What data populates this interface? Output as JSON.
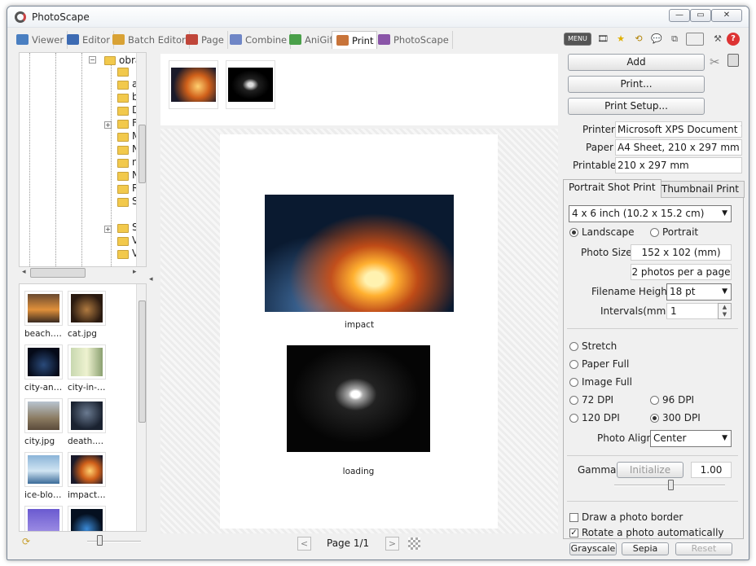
{
  "window": {
    "title": "PhotoScape"
  },
  "window_controls": {
    "minimize": "—",
    "restore": "▭",
    "close": "✕"
  },
  "tabs": [
    {
      "label": "Viewer",
      "color": "#4a7fc1"
    },
    {
      "label": "Editor",
      "color": "#3d6bb3"
    },
    {
      "label": "Batch Editor",
      "color": "#d9a235"
    },
    {
      "label": "Page",
      "color": "#c0463a"
    },
    {
      "label": "Combine",
      "color": "#6f86c6"
    },
    {
      "label": "AniGif",
      "color": "#4aa04a"
    },
    {
      "label": "Print",
      "color": "#c8743a"
    },
    {
      "label": "PhotoScape",
      "color": "#8a55a8"
    }
  ],
  "toolbar_icons": [
    "menu-icon",
    "film-icon",
    "star-icon",
    "refresh-icon",
    "speech-icon",
    "copy-icon",
    "display-icon",
    "tools-icon",
    "help-icon"
  ],
  "toolbar": {
    "menu_label": "MENU"
  },
  "tree": {
    "root_label": "obra",
    "items": [
      "",
      "a",
      "b",
      "D",
      "F",
      "M",
      "N",
      "n",
      "N",
      "R",
      "S",
      "S",
      "V",
      "V"
    ]
  },
  "file_thumbs": [
    {
      "label": "beach.…",
      "img": "beach"
    },
    {
      "label": "cat.jpg",
      "img": "cat"
    },
    {
      "label": "city-an…",
      "img": "cityan"
    },
    {
      "label": "city-in-…",
      "img": "cityin"
    },
    {
      "label": "city.jpg",
      "img": "city"
    },
    {
      "label": "death.…",
      "img": "death"
    },
    {
      "label": "ice-blo…",
      "img": "ice"
    },
    {
      "label": "impact…",
      "img": "impact"
    },
    {
      "label": "",
      "img": "purple"
    },
    {
      "label": "",
      "img": "planet"
    }
  ],
  "page": {
    "captions": [
      "impact",
      "loading"
    ],
    "nav_label": "Page 1/1"
  },
  "actions": {
    "add": "Add",
    "print": "Print...",
    "print_setup": "Print Setup..."
  },
  "printer_info": {
    "printer_label": "Printer",
    "printer_value": "Microsoft XPS Document Wr",
    "paper_label": "Paper",
    "paper_value": "A4 Sheet, 210 x 297 mm",
    "printable_label": "Printable",
    "printable_value": "210 x 297 mm"
  },
  "print_tabs": [
    "Portrait Shot Print",
    "Thumbnail Print"
  ],
  "settings": {
    "size_option": "4 x 6 inch (10.2 x 15.2 cm)",
    "landscape": "Landscape",
    "portrait": "Portrait",
    "photo_size_label": "Photo Size",
    "photo_size_value": "152 x 102 (mm)",
    "photos_per_page": "2 photos per a page",
    "filename_height_label": "Filename Height",
    "filename_height_value": "18 pt",
    "intervals_label": "Intervals(mm)",
    "intervals_value": "1",
    "stretch": "Stretch",
    "paper_full": "Paper Full",
    "image_full": "Image Full",
    "dpi72": "72 DPI",
    "dpi96": "96 DPI",
    "dpi120": "120 DPI",
    "dpi300": "300 DPI",
    "photo_align_label": "Photo Align",
    "photo_align_value": "Center",
    "gamma_label": "Gamma",
    "initialize": "Initialize",
    "gamma_value": "1.00",
    "draw_border": "Draw a photo border",
    "rotate_auto": "Rotate a photo automatically",
    "grayscale": "Grayscale",
    "sepia": "Sepia",
    "reset": "Reset"
  }
}
